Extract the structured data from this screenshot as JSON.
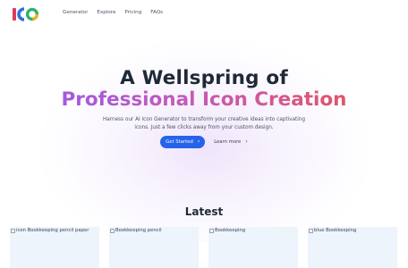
{
  "nav": {
    "logo_text": "ICO",
    "links": [
      "Generator",
      "Explore",
      "Pricing",
      "FAQs"
    ]
  },
  "hero": {
    "title_line1": "A Wellspring of",
    "title_line2": "Professional Icon Creation",
    "subtitle": "Harness our AI Icon Generator to transform your creative ideas into captivating icons. Just a few clicks away from your custom design.",
    "primary_cta": "Get Started",
    "secondary_cta": "Learn more"
  },
  "latest": {
    "heading": "Latest",
    "cards": [
      {
        "alt": "icon Bookkeeping pencil paper"
      },
      {
        "alt": "Bookkeeping pencil"
      },
      {
        "alt": "Bookkeeping"
      },
      {
        "alt": "blue Bookkeeping"
      }
    ]
  },
  "colors": {
    "primary": "#2563eb",
    "gradient_start": "#a25adf",
    "gradient_end": "#e2546a",
    "card_bg": "#eef4fc"
  }
}
